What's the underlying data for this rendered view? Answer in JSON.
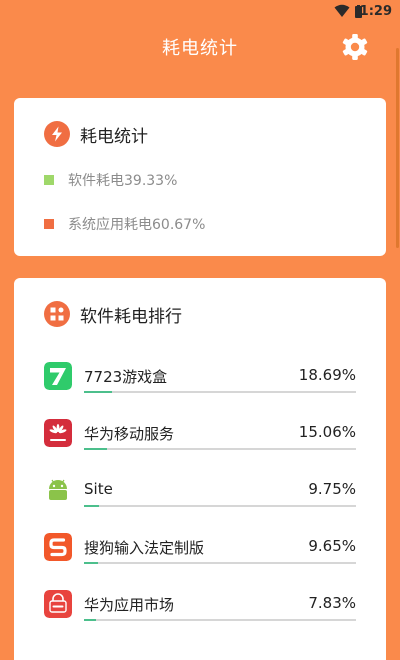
{
  "status_bar": {
    "time": "1:29"
  },
  "header": {
    "title": "耗电统计"
  },
  "summary_card": {
    "title": "耗电统计",
    "legend": [
      {
        "text": "软件耗电39.33%",
        "color": "#9FD86A"
      },
      {
        "text": "系统应用耗电60.67%",
        "color": "#F06E42"
      }
    ]
  },
  "ranking_card": {
    "title": "软件耗电排行",
    "apps": [
      {
        "name": "7723游戏盒",
        "percent": "18.69%",
        "share": 18.69,
        "icon": "7723-app-icon"
      },
      {
        "name": "华为移动服务",
        "percent": "15.06%",
        "share": 15.06,
        "icon": "huawei-hms-icon"
      },
      {
        "name": "Site",
        "percent": "9.75%",
        "share": 9.75,
        "icon": "android-robot-icon"
      },
      {
        "name": "搜狗输入法定制版",
        "percent": "9.65%",
        "share": 9.65,
        "icon": "sogou-input-icon"
      },
      {
        "name": "华为应用市场",
        "percent": "7.83%",
        "share": 7.83,
        "icon": "huawei-appgallery-icon"
      }
    ]
  },
  "colors": {
    "background": "#FA8A4B",
    "accent": "#F06E42",
    "bar_fill": "#4CBF8C",
    "bar_track": "#D6D6D6"
  }
}
